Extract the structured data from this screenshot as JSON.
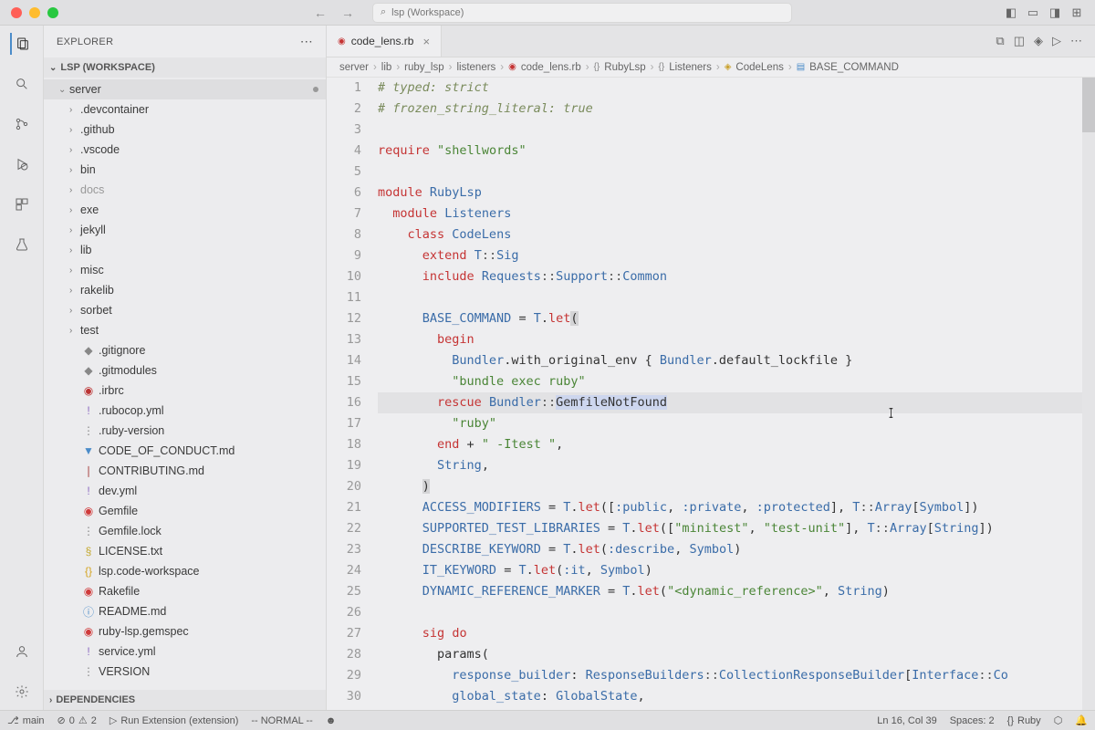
{
  "titlebar": {
    "search_text": "lsp (Workspace)"
  },
  "sidebar": {
    "header": "EXPLORER",
    "workspace_section": "LSP (WORKSPACE)",
    "deps_section": "DEPENDENCIES",
    "server_folder": "server",
    "folders": [
      ".devcontainer",
      ".github",
      ".vscode",
      "bin",
      "docs",
      "exe",
      "jekyll",
      "lib",
      "misc",
      "rakelib",
      "sorbet",
      "test"
    ],
    "files": [
      {
        "name": ".gitignore",
        "cls": "fi-git",
        "icon": "◆"
      },
      {
        "name": ".gitmodules",
        "cls": "fi-git",
        "icon": "◆"
      },
      {
        "name": ".irbrc",
        "cls": "fi-ruby",
        "icon": "◉"
      },
      {
        "name": ".rubocop.yml",
        "cls": "fi-yaml",
        "icon": "!"
      },
      {
        "name": ".ruby-version",
        "cls": "fi-ver",
        "icon": "⋮"
      },
      {
        "name": "CODE_OF_CONDUCT.md",
        "cls": "fi-md",
        "icon": "▼"
      },
      {
        "name": "CONTRIBUTING.md",
        "cls": "fi-doc",
        "icon": "❘"
      },
      {
        "name": "dev.yml",
        "cls": "fi-yaml",
        "icon": "!"
      },
      {
        "name": "Gemfile",
        "cls": "fi-gem",
        "icon": "◉"
      },
      {
        "name": "Gemfile.lock",
        "cls": "fi-ver",
        "icon": "⋮"
      },
      {
        "name": "LICENSE.txt",
        "cls": "fi-lic",
        "icon": "§"
      },
      {
        "name": "lsp.code-workspace",
        "cls": "fi-json",
        "icon": "{}"
      },
      {
        "name": "Rakefile",
        "cls": "fi-gem",
        "icon": "◉"
      },
      {
        "name": "README.md",
        "cls": "fi-md",
        "icon": "ⓘ"
      },
      {
        "name": "ruby-lsp.gemspec",
        "cls": "fi-gem",
        "icon": "◉"
      },
      {
        "name": "service.yml",
        "cls": "fi-yaml",
        "icon": "!"
      },
      {
        "name": "VERSION",
        "cls": "fi-ver",
        "icon": "⋮"
      }
    ]
  },
  "tab": {
    "filename": "code_lens.rb",
    "close": "×"
  },
  "breadcrumbs": {
    "parts": [
      "server",
      "lib",
      "ruby_lsp",
      "listeners",
      "code_lens.rb",
      "RubyLsp",
      "Listeners",
      "CodeLens",
      "BASE_COMMAND"
    ]
  },
  "statusbar": {
    "branch": "main",
    "errors": "0",
    "warnings": "2",
    "run_ext": "Run Extension (extension)",
    "vim_mode": "-- NORMAL --",
    "line_col": "Ln 16, Col 39",
    "spaces": "Spaces: 2",
    "lang": "Ruby"
  },
  "code": {
    "line_count": 30
  }
}
